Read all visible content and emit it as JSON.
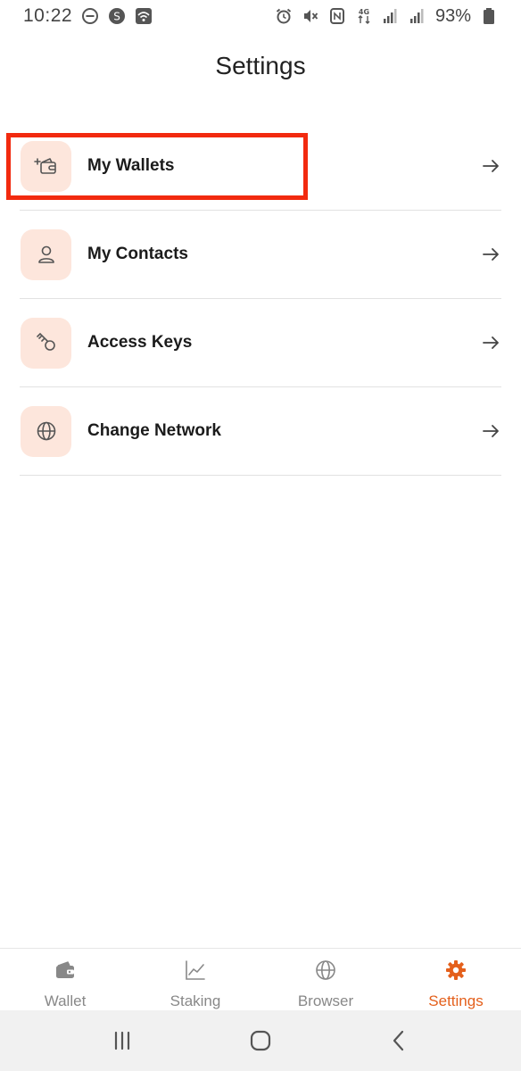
{
  "status_bar": {
    "time": "10:22",
    "battery": "93%",
    "icons_left": [
      "do-not-disturb-icon",
      "shazam-icon",
      "wifi-hotspot-icon"
    ],
    "icons_right": [
      "alarm-icon",
      "mute-icon",
      "nfc-icon",
      "4g-icon",
      "signal-icon",
      "signal-icon",
      "battery-icon"
    ]
  },
  "header": {
    "title": "Settings"
  },
  "colors": {
    "accent": "#e4601c",
    "icon_bg": "#fde6dc",
    "highlight": "#f22a0f"
  },
  "settings": {
    "items": [
      {
        "label": "My Wallets",
        "icon": "add-wallet-icon"
      },
      {
        "label": "My Contacts",
        "icon": "person-icon"
      },
      {
        "label": "Access Keys",
        "icon": "key-icon"
      },
      {
        "label": "Change Network",
        "icon": "globe-icon"
      }
    ]
  },
  "bottom_nav": {
    "items": [
      {
        "label": "Wallet",
        "icon": "wallet-icon",
        "active": false
      },
      {
        "label": "Staking",
        "icon": "chart-icon",
        "active": false
      },
      {
        "label": "Browser",
        "icon": "globe-icon",
        "active": false
      },
      {
        "label": "Settings",
        "icon": "gear-icon",
        "active": true
      }
    ]
  },
  "system_nav": {
    "buttons": [
      "recent-apps-icon",
      "home-icon",
      "back-icon"
    ]
  }
}
